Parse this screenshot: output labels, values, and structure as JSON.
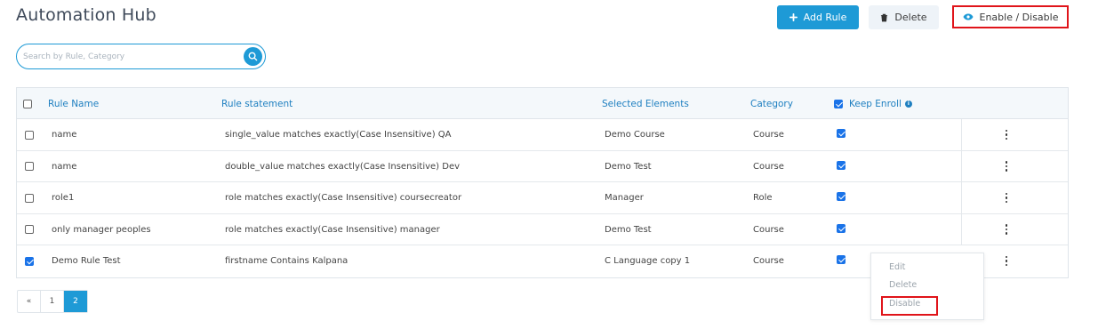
{
  "page": {
    "title": "Automation Hub"
  },
  "toolbar": {
    "add_label": "Add Rule",
    "delete_label": "Delete",
    "enable_disable_label": "Enable / Disable"
  },
  "search": {
    "placeholder": "Search by Rule, Category"
  },
  "table": {
    "headers": {
      "rule_name": "Rule Name",
      "rule_statement": "Rule statement",
      "selected_elements": "Selected Elements",
      "category": "Category",
      "keep_enroll": "Keep Enroll"
    },
    "rows": [
      {
        "name": "name",
        "statement": "single_value matches exactly(Case Insensitive) QA",
        "elements": "Demo Course",
        "category": "Course",
        "selected": false,
        "keep_enroll": true
      },
      {
        "name": "name",
        "statement": "double_value matches exactly(Case Insensitive) Dev",
        "elements": "Demo Test",
        "category": "Course",
        "selected": false,
        "keep_enroll": true
      },
      {
        "name": "role1",
        "statement": "role matches exactly(Case Insensitive) coursecreator",
        "elements": "Manager",
        "category": "Role",
        "selected": false,
        "keep_enroll": true
      },
      {
        "name": "only manager peoples",
        "statement": "role matches exactly(Case Insensitive) manager",
        "elements": "Demo Test",
        "category": "Course",
        "selected": false,
        "keep_enroll": true
      },
      {
        "name": "Demo Rule Test",
        "statement": "firstname Contains Kalpana",
        "elements": "C Language copy 1",
        "category": "Course",
        "selected": true,
        "keep_enroll": true
      }
    ]
  },
  "context_menu": {
    "items": [
      "Edit",
      "Delete",
      "Disable"
    ]
  },
  "pagination": {
    "prev": "«",
    "pages": [
      "1",
      "2"
    ],
    "current": "2"
  },
  "colors": {
    "accent": "#1e9ad6",
    "highlight": "#e0141a"
  }
}
